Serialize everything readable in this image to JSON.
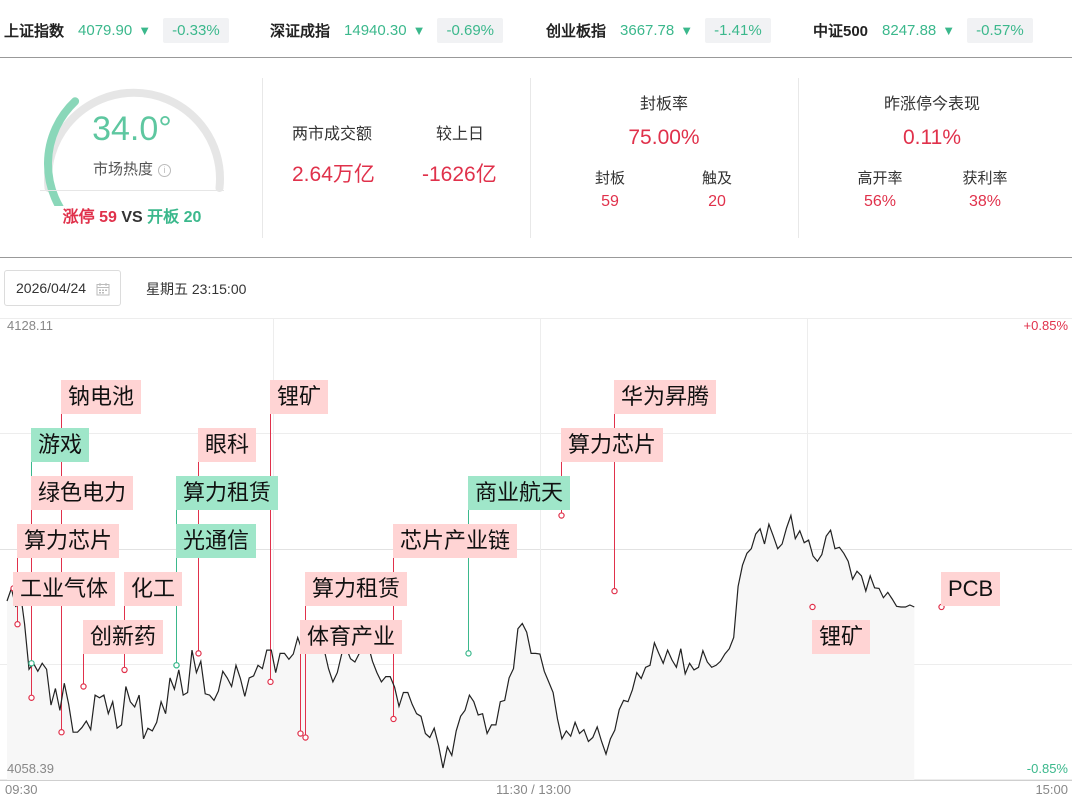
{
  "indices": [
    {
      "name": "上证指数",
      "value": "4079.90",
      "arrow": "▼",
      "change": "-0.33%"
    },
    {
      "name": "深证成指",
      "value": "14940.30",
      "arrow": "▼",
      "change": "-0.69%"
    },
    {
      "name": "创业板指",
      "value": "3667.78",
      "arrow": "▼",
      "change": "-1.41%"
    },
    {
      "name": "中证500",
      "value": "8247.88",
      "arrow": "▼",
      "change": "-0.57%"
    }
  ],
  "heat": {
    "temperature": "34.0°",
    "temperature_value": 34.0,
    "label": "市场热度",
    "info_icon": "ⓘ",
    "limit_up_label": "涨停",
    "limit_up_count": "59",
    "vs": "VS",
    "opened_label": "开板",
    "opened_count": "20"
  },
  "turnover": {
    "title": "两市成交额",
    "value": "2.64万亿",
    "compare_title": "较上日",
    "compare_value": "-1626亿"
  },
  "seal_rate": {
    "title": "封板率",
    "value": "75.00%",
    "sealed_label": "封板",
    "sealed_value": "59",
    "touched_label": "触及",
    "touched_value": "20"
  },
  "yesterday": {
    "title": "昨涨停今表现",
    "value": "0.11%",
    "high_open_label": "高开率",
    "high_open_value": "56%",
    "profit_label": "获利率",
    "profit_value": "38%"
  },
  "date_picker": {
    "value": "2026/04/24",
    "icon": "calendar-icon"
  },
  "weekday_time": "星期五 23:15:00",
  "colors": {
    "up": "#e0314b",
    "down": "#3bb88c",
    "up_chip": "#ffd4d4",
    "down_chip": "#9fe6c9"
  },
  "chart_data": {
    "type": "line",
    "y_max_label": "4128.11",
    "y_min_label": "4058.39",
    "right_max_label": "+0.85%",
    "right_min_label": "-0.85%",
    "ylim": [
      4058.39,
      4128.11
    ],
    "x_labels": [
      "09:30",
      "11:30 / 13:00",
      "15:00"
    ],
    "series": [
      {
        "values": [
          4085.4,
          4087.3,
          4084.5,
          4086.9,
          4081.9,
          4075.1,
          4076.0,
          4074.8,
          4076.0,
          4075.1,
          4069.7,
          4072.2,
          4068.9,
          4073.0,
          4069.8,
          4065.6,
          4065.6,
          4066.3,
          4067.3,
          4066.0,
          4071.2,
          4070.8,
          4071.2,
          4068.4,
          4070.2,
          4066.2,
          4066.7,
          4072.5,
          4070.2,
          4069.4,
          4071.2,
          4064.6,
          4066.2,
          4065.8,
          4067.1,
          4070.2,
          4068.4,
          4073.8,
          4072.1,
          4075.0,
          4071.2,
          4071.6,
          4078.0,
          4074.6,
          4076.3,
          4071.4,
          4071.2,
          4070.4,
          4071.8,
          4074.8,
          4073.8,
          4072.5,
          4075.7,
          4073.7,
          4071.0,
          4073.8,
          4074.1,
          4075.7,
          4075.2,
          4078.0,
          4078.0,
          4074.6,
          4077.5,
          4077.5,
          4076.6,
          4077.4,
          4079.9,
          4078.0,
          4079.1,
          4079.9,
          4080.1,
          4077.7,
          4078.1,
          4075.2,
          4073.2,
          4074.6,
          4077.4,
          4078.4,
          4076.7,
          4076.2,
          4077.5,
          4078.9,
          4078.8,
          4076.3,
          4074.6,
          4073.2,
          4074.0,
          4074.0,
          4072.4,
          4069.5,
          4071.6,
          4071.6,
          4069.8,
          4068.4,
          4068.0,
          4065.4,
          4064.8,
          4066.2,
          4063.6,
          4060.2,
          4063.4,
          4062.1,
          4065.8,
          4068.0,
          4068.9,
          4071.2,
          4070.2,
          4068.2,
          4068.4,
          4065.4,
          4066.7,
          4066.7,
          4070.2,
          4070.4,
          4073.8,
          4075.2,
          4081.2,
          4082.0,
          4080.7,
          4077.5,
          4077.5,
          4077.4,
          4074.8,
          4073.2,
          4071.6,
          4067.6,
          4064.6,
          4065.8,
          4065.0,
          4067.1,
          4065.4,
          4066.0,
          4064.2,
          4064.8,
          4066.4,
          4064.2,
          4062.3,
          4064.6,
          4065.9,
          4069.0,
          4070.4,
          4070.2,
          4072.0,
          4074.6,
          4073.7,
          4075.4,
          4075.7,
          4079.1,
          4077.5,
          4076.0,
          4078.0,
          4076.5,
          4075.4,
          4078.2,
          4074.4,
          4076.0,
          4075.0,
          4075.4,
          4077.9,
          4076.2,
          4075.4,
          4075.7,
          4076.3,
          4077.4,
          4078.2,
          4079.9,
          4087.6,
          4090.8,
          4092.6,
          4093.3,
          4095.5,
          4096.3,
          4094.0,
          4097.0,
          4095.2,
          4093.3,
          4094.0,
          4096.4,
          4098.3,
          4094.8,
          4096.0,
          4094.2,
          4094.6,
          4092.2,
          4091.4,
          4092.4,
          4095.2,
          4096.1,
          4093.3,
          4093.5,
          4092.6,
          4091.4,
          4088.7,
          4089.9,
          4089.2,
          4086.9,
          4089.2,
          4087.4,
          4087.3,
          4085.9,
          4086.7,
          4085.7,
          4084.6,
          4084.5,
          4084.5,
          4084.8,
          4084.5
        ],
        "color": "#222222"
      }
    ],
    "baseline": 4093.25,
    "events": [
      {
        "label": "钠电池",
        "kind": "up",
        "i": 19
      },
      {
        "label": "游戏",
        "kind": "down",
        "i": 9
      },
      {
        "label": "绿色电力",
        "kind": "up",
        "i": 25
      },
      {
        "label": "算力芯片",
        "kind": "up",
        "i": 5
      },
      {
        "label": "工业气体",
        "kind": "up",
        "i": 1
      },
      {
        "label": "创新药",
        "kind": "up",
        "i": 31
      },
      {
        "label": "化工",
        "kind": "up",
        "i": 45
      },
      {
        "label": "眼科",
        "kind": "up",
        "i": 72
      },
      {
        "label": "算力租赁",
        "kind": "down",
        "i": 66
      },
      {
        "label": "光通信",
        "kind": "down",
        "i": 66
      },
      {
        "label": "锂矿",
        "kind": "up",
        "i": 99
      },
      {
        "label": "算力租赁",
        "kind": "up",
        "i": 112
      },
      {
        "label": "体育产业",
        "kind": "up",
        "i": 111
      },
      {
        "label": "芯片产业链",
        "kind": "up",
        "i": 146
      },
      {
        "label": "商业航天",
        "kind": "down",
        "i": 172
      },
      {
        "label": "算力芯片",
        "kind": "up",
        "i": 207
      },
      {
        "label": "华为昇腾",
        "kind": "up",
        "i": 227
      },
      {
        "label": "锂矿",
        "kind": "up",
        "i": 299
      },
      {
        "label": "PCB",
        "kind": "up",
        "i": 348
      }
    ]
  }
}
